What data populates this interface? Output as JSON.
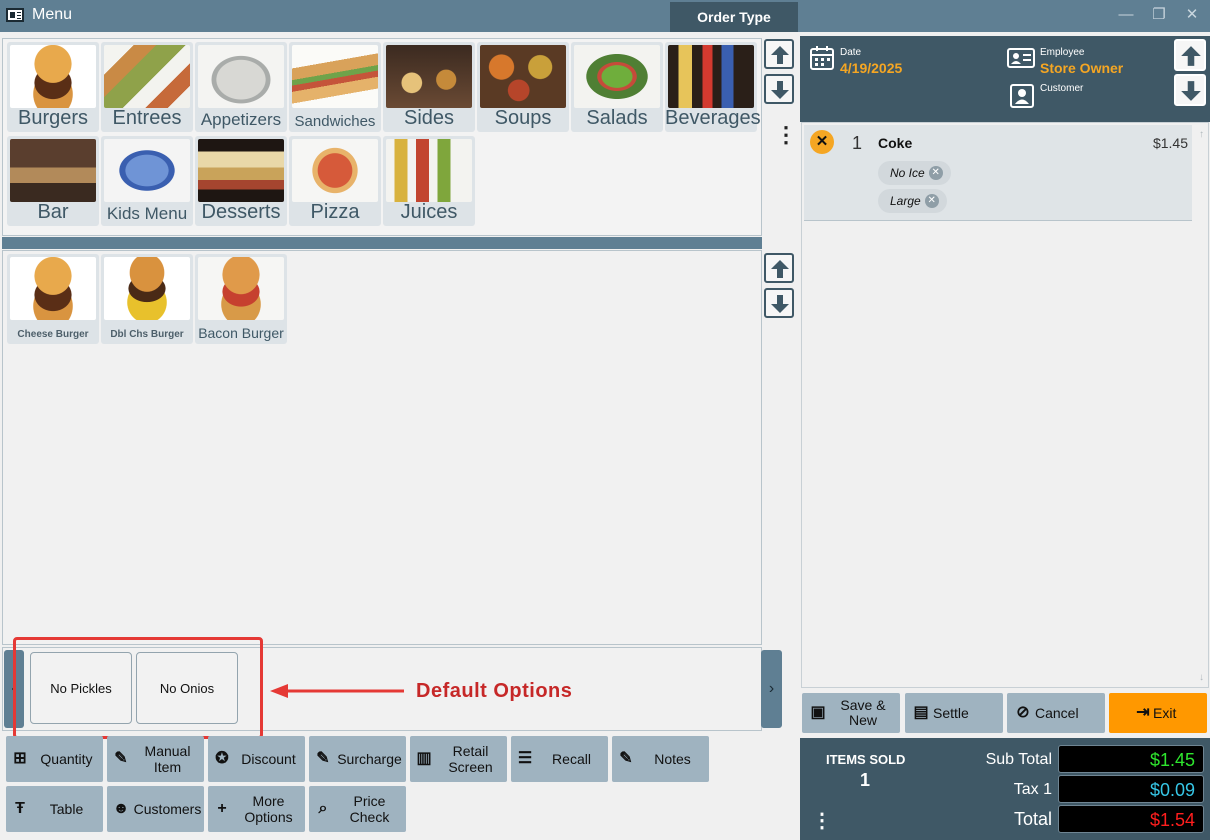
{
  "window": {
    "title": "Menu",
    "order_type_label": "Order Type",
    "controls": {
      "minimize": "—",
      "restore": "❐",
      "close": "✕"
    }
  },
  "categories": [
    {
      "label": "Burgers",
      "icon": "burger-photo",
      "color": "#c8742d"
    },
    {
      "label": "Entrees",
      "icon": "kebab-photo",
      "color": "#8fa24a"
    },
    {
      "label": "Appetizers",
      "icon": "platter-photo",
      "color": "#b5b8b6"
    },
    {
      "label": "Sandwiches",
      "icon": "sandwich-photo",
      "color": "#d6a15c"
    },
    {
      "label": "Sides",
      "icon": "sides-photo",
      "color": "#6a4a34"
    },
    {
      "label": "Soups",
      "icon": "soups-photo",
      "color": "#c5702b"
    },
    {
      "label": "Salads",
      "icon": "salad-photo",
      "color": "#4f7f34"
    },
    {
      "label": "Beverages",
      "icon": "beverages-photo",
      "color": "#7b6a55"
    },
    {
      "label": "Bar",
      "icon": "bar-photo",
      "color": "#6b5141"
    },
    {
      "label": "Kids Menu",
      "icon": "kids-photo",
      "color": "#5a7fc6"
    },
    {
      "label": "Desserts",
      "icon": "desserts-photo",
      "color": "#c9a35a"
    },
    {
      "label": "Pizza",
      "icon": "pizza-photo",
      "color": "#d65a3a"
    },
    {
      "label": "Juices",
      "icon": "juices-photo",
      "color": "#d8b23e"
    }
  ],
  "items": [
    {
      "label": "Cheese Burger",
      "icon": "cheeseburger-photo",
      "color": "#c27a33"
    },
    {
      "label": "Dbl Chs Burger",
      "icon": "double-burger-photo",
      "color": "#a9652c"
    },
    {
      "label": "Bacon Burger",
      "icon": "bacon-burger-photo",
      "color": "#b65a34"
    }
  ],
  "default_options": {
    "buttons": [
      "No Pickles",
      "No Onios"
    ],
    "annotation": "Default Options"
  },
  "function_buttons": [
    {
      "label": "Quantity",
      "icon": "quantity-icon"
    },
    {
      "label": "Manual Item",
      "icon": "manual-item-icon"
    },
    {
      "label": "Discount",
      "icon": "discount-icon"
    },
    {
      "label": "Surcharge",
      "icon": "surcharge-icon"
    },
    {
      "label": "Retail Screen",
      "icon": "barcode-icon"
    },
    {
      "label": "Recall",
      "icon": "recall-icon"
    },
    {
      "label": "Notes",
      "icon": "notes-icon"
    },
    {
      "label": "Table",
      "icon": "table-icon"
    },
    {
      "label": "Customers",
      "icon": "customers-icon"
    },
    {
      "label": "More Options",
      "icon": "plus-icon"
    },
    {
      "label": "Price Check",
      "icon": "price-check-icon"
    }
  ],
  "header": {
    "date_label": "Date",
    "date_value": "4/19/2025",
    "employee_label": "Employee",
    "employee_value": "Store Owner",
    "customer_label": "Customer"
  },
  "order": {
    "lines": [
      {
        "qty": "1",
        "name": "Coke",
        "price": "$1.45",
        "modifiers": [
          "No Ice",
          "Large"
        ]
      }
    ]
  },
  "actions": [
    {
      "label": "Save & New",
      "icon": "save-icon"
    },
    {
      "label": "Settle",
      "icon": "cash-icon"
    },
    {
      "label": "Cancel",
      "icon": "cancel-icon"
    },
    {
      "label": "Exit",
      "icon": "exit-icon"
    }
  ],
  "totals": {
    "items_sold_label": "ITEMS SOLD",
    "items_sold": "1",
    "subtotal_label": "Sub Total",
    "subtotal": "$1.45",
    "subtotal_color": "#2ee62e",
    "tax_label": "Tax 1",
    "tax": "$0.09",
    "tax_color": "#36c6e6",
    "total_label": "Total",
    "total": "$1.54",
    "total_color": "#ff1e1e"
  }
}
